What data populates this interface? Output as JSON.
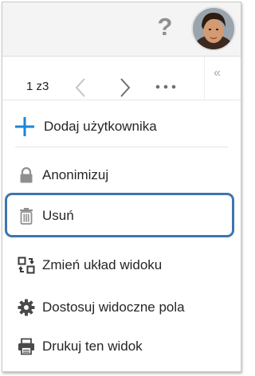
{
  "header": {
    "help_icon": "question-mark-icon",
    "help_glyph": "?",
    "avatar": "user-avatar-photo"
  },
  "pager": {
    "current_page": "1",
    "separator": "z",
    "total_pages": "3",
    "prev_icon": "chevron-left-icon",
    "next_icon": "chevron-right-icon",
    "more_icon": "more-horizontal-icon",
    "collapse_icon": "double-chevron-left-icon",
    "collapse_glyph": "«"
  },
  "menu": {
    "items": [
      {
        "label": "Dodaj użytkownika",
        "icon": "plus-icon"
      },
      {
        "label": "Anonimizuj",
        "icon": "lock-icon"
      },
      {
        "label": "Usuń",
        "icon": "trash-icon",
        "highlighted": true
      },
      {
        "label": "Zmień układ widoku",
        "icon": "switch-layout-icon"
      },
      {
        "label": "Dostosuj widoczne pola",
        "icon": "gear-icon"
      },
      {
        "label": "Drukuj ten widok",
        "icon": "printer-icon"
      }
    ]
  },
  "colors": {
    "accent_blue": "#1a86d6",
    "highlight_border": "#3e75ad",
    "icon_gray": "#8f8f8f",
    "topbar_bg": "#f4f4f4"
  }
}
